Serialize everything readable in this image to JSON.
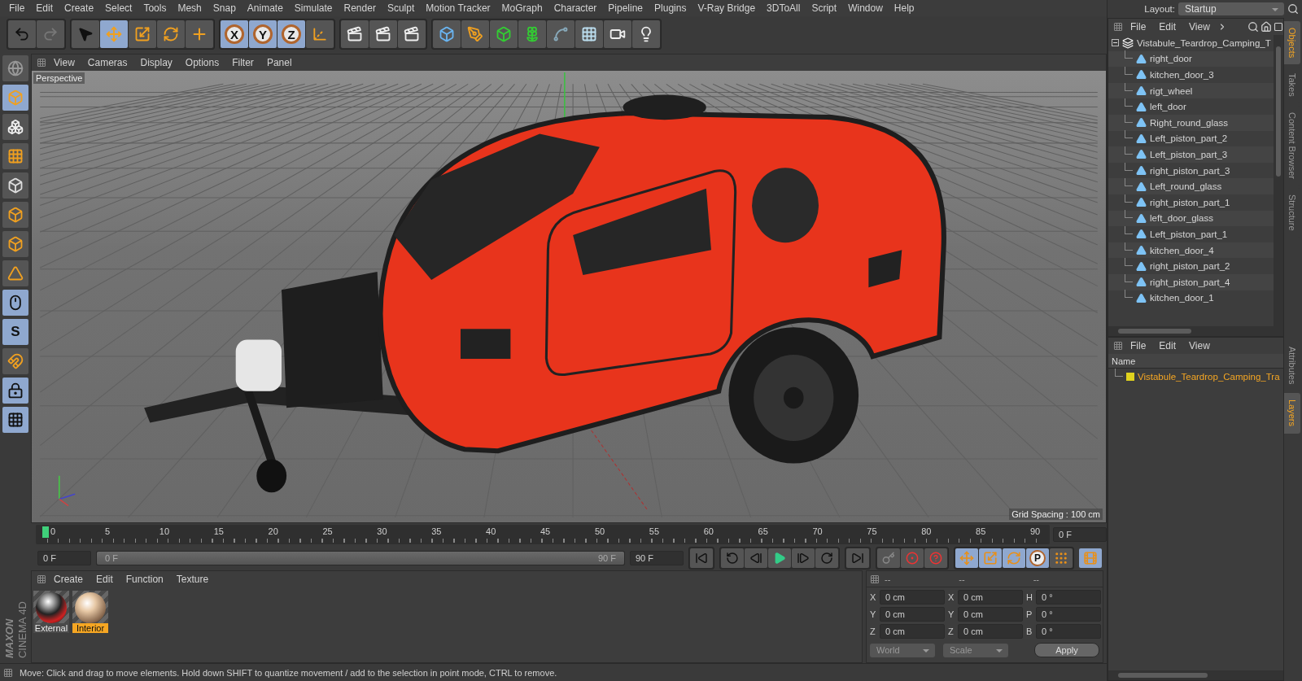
{
  "menu_bar": [
    "File",
    "Edit",
    "Create",
    "Select",
    "Tools",
    "Mesh",
    "Snap",
    "Animate",
    "Simulate",
    "Render",
    "Sculpt",
    "Motion Tracker",
    "MoGraph",
    "Character",
    "Pipeline",
    "Plugins",
    "V-Ray Bridge",
    "3DToAll",
    "Script",
    "Window",
    "Help"
  ],
  "layout": {
    "label": "Layout:",
    "value": "Startup"
  },
  "toolbar": {
    "tools": [
      {
        "kind": "select",
        "selected": false
      },
      {
        "kind": "move",
        "selected": true
      },
      {
        "kind": "scale",
        "selected": false
      },
      {
        "kind": "rotate",
        "selected": false
      },
      {
        "kind": "transform",
        "selected": false
      }
    ],
    "axes": [
      {
        "label": "X",
        "selected": true
      },
      {
        "label": "Y",
        "selected": true
      },
      {
        "label": "Z",
        "selected": true
      }
    ]
  },
  "left_toolbar": {
    "snap_letter": "S",
    "logo": [
      "MAXON",
      "CINEMA 4D"
    ]
  },
  "viewport": {
    "menu": [
      "View",
      "Cameras",
      "Display",
      "Options",
      "Filter",
      "Panel"
    ],
    "camera_label": "Perspective",
    "grid_spacing": "Grid Spacing : 100 cm"
  },
  "timeline": {
    "ticks": [
      "0",
      "5",
      "10",
      "15",
      "20",
      "25",
      "30",
      "35",
      "40",
      "45",
      "50",
      "55",
      "60",
      "65",
      "70",
      "75",
      "80",
      "85",
      "90"
    ],
    "current_frame": "0 F",
    "start_field": "0 F",
    "range": {
      "start": "0 F",
      "end": "90 F",
      "level": 1
    },
    "end_field": "90 F",
    "key_filters": [
      {
        "kind": "position",
        "on": true
      },
      {
        "kind": "scale",
        "on": true
      },
      {
        "kind": "rotation",
        "on": true
      },
      {
        "kind": "parameter",
        "label": "P",
        "on": true
      },
      {
        "kind": "points",
        "on": false
      }
    ]
  },
  "material_manager": {
    "menu": [
      "Create",
      "Edit",
      "Function",
      "Texture"
    ],
    "materials": [
      {
        "name": "External",
        "kind": "red",
        "selected": false
      },
      {
        "name": "Interior",
        "kind": "beige",
        "selected": true
      }
    ]
  },
  "coordinates": {
    "headers": [
      "--",
      "--",
      "--"
    ],
    "columns": [
      {
        "rows": [
          {
            "axis": "X",
            "value": "0 cm"
          },
          {
            "axis": "Y",
            "value": "0 cm"
          },
          {
            "axis": "Z",
            "value": "0 cm"
          }
        ]
      },
      {
        "rows": [
          {
            "axis": "X",
            "value": "0 cm"
          },
          {
            "axis": "Y",
            "value": "0 cm"
          },
          {
            "axis": "Z",
            "value": "0 cm"
          }
        ]
      },
      {
        "rows": [
          {
            "axis": "H",
            "value": "0 °"
          },
          {
            "axis": "P",
            "value": "0 °"
          },
          {
            "axis": "B",
            "value": "0 °"
          }
        ]
      }
    ],
    "dropdowns": [
      "World",
      "Scale"
    ],
    "apply": "Apply"
  },
  "status_bar": "Move: Click and drag to move elements. Hold down SHIFT to quantize movement / add to the selection in point mode, CTRL to remove.",
  "object_manager": {
    "menu": [
      "File",
      "Edit",
      "View"
    ],
    "tree": [
      {
        "label": "Vistabule_Teardrop_Camping_T",
        "expanded": true,
        "children": [
          {
            "label": "right_door"
          },
          {
            "label": "kitchen_door_3"
          },
          {
            "label": "rigt_wheel"
          },
          {
            "label": "left_door"
          },
          {
            "label": "Right_round_glass"
          },
          {
            "label": "Left_piston_part_2"
          },
          {
            "label": "Left_piston_part_3"
          },
          {
            "label": "right_piston_part_3"
          },
          {
            "label": "Left_round_glass"
          },
          {
            "label": "right_piston_part_1"
          },
          {
            "label": "left_door_glass"
          },
          {
            "label": "Left_piston_part_1"
          },
          {
            "label": "kitchen_door_4"
          },
          {
            "label": "right_piston_part_2"
          },
          {
            "label": "right_piston_part_4"
          },
          {
            "label": "kitchen_door_1"
          }
        ]
      }
    ]
  },
  "layer_manager": {
    "menu": [
      "File",
      "Edit",
      "View"
    ],
    "column": "Name",
    "layers": [
      {
        "name": "Vistabule_Teardrop_Camping_Tra",
        "color": "#e0d21e"
      }
    ]
  },
  "side_tabs": [
    {
      "label": "Objects",
      "selected": true
    },
    {
      "label": "Takes",
      "selected": false
    },
    {
      "label": "Content Browser",
      "selected": false
    },
    {
      "label": "Structure",
      "selected": false
    }
  ],
  "lower_side_tabs": [
    {
      "label": "Attributes",
      "selected": false
    },
    {
      "label": "Layers",
      "selected": true
    }
  ]
}
